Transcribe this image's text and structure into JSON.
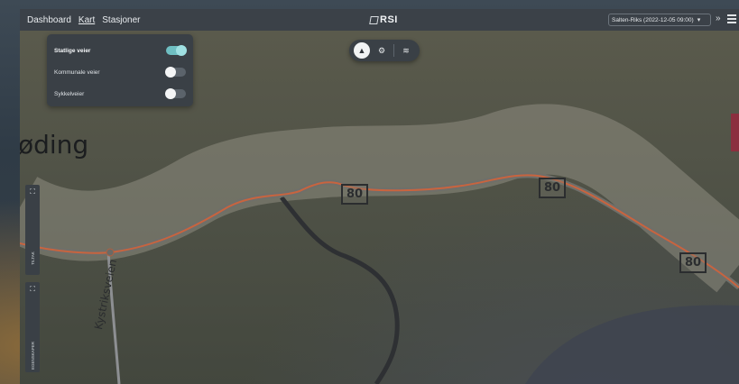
{
  "nav": {
    "items": [
      {
        "label": "Dashboard",
        "active": false
      },
      {
        "label": "Kart",
        "active": true
      },
      {
        "label": "Stasjoner",
        "active": false
      }
    ]
  },
  "logo": {
    "text": "RSI"
  },
  "dataset_select": {
    "value": "Salten-Riks (2022-12-05 09:00)",
    "icon": "chevron-down-icon"
  },
  "header_icons": {
    "collapse": "double-chevron-icon",
    "menu": "hamburger-icon"
  },
  "layer_panel": {
    "rows": [
      {
        "label": "Statlige veier",
        "on": true
      },
      {
        "label": "Kommunale veier",
        "on": false
      },
      {
        "label": "Sykkelveier",
        "on": false
      }
    ]
  },
  "map_tools": {
    "tools": [
      {
        "name": "road-icon",
        "glyph": "▲",
        "active": true
      },
      {
        "name": "tractor-icon",
        "glyph": "⚙",
        "active": false
      },
      {
        "name": "layers-icon",
        "glyph": "≋",
        "active": false
      }
    ]
  },
  "map": {
    "place_label": "øding",
    "road_label": "Kystriksveien",
    "speed_signs": [
      "80",
      "80",
      "80"
    ],
    "colors": {
      "route": "#c8643f",
      "buffer": "#8e8c80",
      "land": "#50544a"
    }
  },
  "side_tabs": [
    {
      "label": "TILTAK",
      "icon": "expand-icon"
    },
    {
      "label": "EGENSKAPER",
      "icon": "expand-icon"
    }
  ]
}
